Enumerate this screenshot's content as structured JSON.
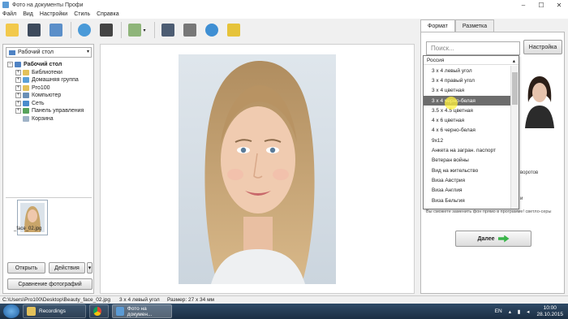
{
  "window": {
    "title": "Фото на документы Профи",
    "controls": [
      "–",
      "☐",
      "✕"
    ]
  },
  "menu": [
    "Файл",
    "Вид",
    "Настройки",
    "Стиль",
    "Справка"
  ],
  "toolbar": {
    "icons": [
      "open-folder-icon",
      "save-icon",
      "print-icon",
      "user-icon",
      "camera-icon",
      "image-icon",
      "help-icon",
      "film-icon",
      "globe-icon",
      "calendar-icon"
    ]
  },
  "left_panel": {
    "folder_select": "Рабочий стол",
    "tree": {
      "root": "Рабочий стол",
      "items": [
        "Библиотеки",
        "Домашняя группа",
        "Pro100",
        "Компьютер",
        "Сеть",
        "Панель управления",
        "Корзина"
      ]
    },
    "thumbnail_label": "_face_02.jpg",
    "open_button": "Открыть",
    "actions_button": "Действия",
    "compare_button": "Сравнение фотографий"
  },
  "right_panel": {
    "tabs": [
      "Формат",
      "Разметка"
    ],
    "search_placeholder": "Поиск...",
    "settings_button": "Настройка",
    "side_text_1": "воротов",
    "side_text_2": "и",
    "hint": "Вы сможете заменить фон прямо в программе!",
    "hint_prefix": "светло-серы",
    "next_button": "Далее"
  },
  "dropdown": {
    "header": "Россия",
    "items": [
      "3 х 4 левый угол",
      "3 х 4 правый угол",
      "3 х 4 цветная",
      "3 х 4 черно-белая",
      "3.5 х 4.5 цветная",
      "4 х 6 цветная",
      "4 х 6 черно-белая",
      "9x12",
      "Анкета на загран. паспорт",
      "Ветеран войны",
      "Вид на жительство",
      "Виза Австрия",
      "Виза Англия",
      "Виза Бельгия"
    ],
    "selected_index": 3
  },
  "statusbar": {
    "path": "C:\\Users\\Pro100\\Desktop\\Beauty_face_02.jpg",
    "format": "3 х 4 левый угол",
    "size": "Размер: 27 х 34 мм"
  },
  "taskbar": {
    "tasks": [
      "Recordings",
      "",
      "Фото на докумен..."
    ],
    "lang": "EN",
    "time": "10:00",
    "date": "28.10.2015"
  }
}
